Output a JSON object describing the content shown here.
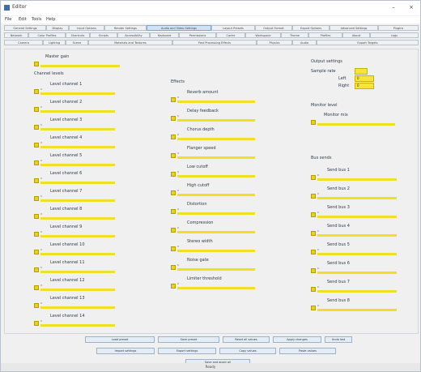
{
  "window": {
    "title": "Editor",
    "minimize": "–",
    "close": "×"
  },
  "menus": [
    "File",
    "Edit",
    "Tools",
    "Help"
  ],
  "tab_rows": [
    [
      {
        "label": "General Settings"
      },
      {
        "label": "Display"
      },
      {
        "label": "Input Options"
      },
      {
        "label": "Render Settings"
      },
      {
        "label": "Audio and Video Settings",
        "active": true
      },
      {
        "label": "Layout Presets"
      },
      {
        "label": "Output Format"
      },
      {
        "label": "Export Options"
      },
      {
        "label": "Advanced Settings"
      },
      {
        "label": "Plugins"
      }
    ],
    [
      {
        "label": "Network"
      },
      {
        "label": "Color Profiles"
      },
      {
        "label": "Shortcuts"
      },
      {
        "label": "Scripts"
      },
      {
        "label": "Accessibility"
      },
      {
        "label": "Keyboard"
      },
      {
        "label": "Permissions"
      },
      {
        "label": "Cache"
      },
      {
        "label": "Workspace"
      },
      {
        "label": "Theme"
      },
      {
        "label": "Profiles"
      },
      {
        "label": "About"
      },
      {
        "label": "Logs"
      }
    ],
    [
      {
        "label": "Camera"
      },
      {
        "label": "Lighting"
      },
      {
        "label": "Scene"
      },
      {
        "label": "Materials and Textures"
      },
      {
        "label": "Post Processing Effects"
      },
      {
        "label": "Physics"
      },
      {
        "label": "Audio"
      },
      {
        "label": "Export Targets"
      }
    ]
  ],
  "master": {
    "label": "Master gain",
    "value": "0"
  },
  "left_group": {
    "title": "Channel levels",
    "items": [
      {
        "label": "Level channel 1",
        "value": "0"
      },
      {
        "label": "Level channel 2",
        "value": "0"
      },
      {
        "label": "Level channel 3",
        "value": "0"
      },
      {
        "label": "Level channel 4",
        "value": "0"
      },
      {
        "label": "Level channel 5",
        "value": "0"
      },
      {
        "label": "Level channel 6",
        "value": "0"
      },
      {
        "label": "Level channel 7",
        "value": "0"
      },
      {
        "label": "Level channel 8",
        "value": "0"
      },
      {
        "label": "Level channel 9",
        "value": "0"
      },
      {
        "label": "Level channel 10",
        "value": "0"
      },
      {
        "label": "Level channel 11",
        "value": "0"
      },
      {
        "label": "Level channel 12",
        "value": "0"
      },
      {
        "label": "Level channel 13",
        "value": "0"
      },
      {
        "label": "Level channel 14",
        "value": "0"
      }
    ]
  },
  "mid_group": {
    "title": "Effects",
    "items": [
      {
        "label": "Reverb amount",
        "value": "0"
      },
      {
        "label": "Delay feedback",
        "value": "0"
      },
      {
        "label": "Chorus depth",
        "value": "0"
      },
      {
        "label": "Flanger speed",
        "value": "0"
      },
      {
        "label": "Low cutoff",
        "value": "0"
      },
      {
        "label": "High cutoff",
        "value": "0"
      },
      {
        "label": "Distortion",
        "value": "0"
      },
      {
        "label": "Compression",
        "value": "0"
      },
      {
        "label": "Stereo width",
        "value": "0"
      },
      {
        "label": "Noise gate",
        "value": "0"
      },
      {
        "label": "Limiter threshold",
        "value": "0"
      }
    ]
  },
  "right_top": {
    "title": "Output settings",
    "resolution_label": "Sample rate",
    "spin_rows": [
      {
        "label": "Left",
        "value": "0"
      },
      {
        "label": "Right",
        "value": "0"
      }
    ],
    "group2_title": "Monitor level",
    "group2_item": {
      "label": "Monitor mix",
      "value": "0"
    }
  },
  "right_group": {
    "title": "Bus sends",
    "items": [
      {
        "label": "Send bus 1",
        "value": "0"
      },
      {
        "label": "Send bus 2",
        "value": "0"
      },
      {
        "label": "Send bus 3",
        "value": "0"
      },
      {
        "label": "Send bus 4",
        "value": "0"
      },
      {
        "label": "Send bus 5",
        "value": "0"
      },
      {
        "label": "Send bus 6",
        "value": "0"
      },
      {
        "label": "Send bus 7",
        "value": "0"
      },
      {
        "label": "Send bus 8",
        "value": "0"
      }
    ]
  },
  "buttons_row1": [
    "Load preset",
    "Save preset",
    "Reset all values",
    "Apply changes",
    "Undo last"
  ],
  "buttons_row2": [
    "Import settings",
    "Export settings",
    "Copy values",
    "Paste values"
  ],
  "button_wide": "Save and apply all",
  "status": "Ready"
}
